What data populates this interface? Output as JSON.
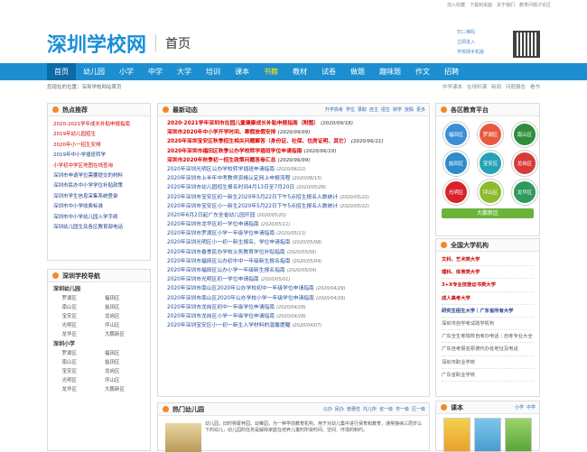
{
  "toplinks": [
    "加入收藏",
    "下载到桌面",
    "关于我们",
    "教育问题讨论区"
  ],
  "logo": {
    "text": "深圳学校网",
    "home": "首页"
  },
  "qr_links": [
    "扫二维码",
    "立即进入",
    "学校网手机版"
  ],
  "nav": [
    "首页",
    "幼儿园",
    "小学",
    "中学",
    "大学",
    "培训",
    "课本",
    "书籍",
    "教材",
    "试卷",
    "做题",
    "趣味题",
    "作文",
    "招聘"
  ],
  "crumb": {
    "text": "您现在的位置：深圳学校网站首页",
    "right": [
      "中学课本",
      "在线听课",
      "新闻",
      "问题报告",
      "看书"
    ]
  },
  "hot": {
    "title": "热点推荐",
    "items": [
      {
        "text": "2020-2021学年成长补贴申报指南",
        "c": "r"
      },
      {
        "text": "2019年幼儿园招生",
        "c": "r"
      },
      {
        "text": "2020年小一招生安排",
        "c": "r"
      },
      {
        "text": "2019年中小学插班转学",
        "c": "b"
      },
      {
        "text": "小学初中学区地图在线查询",
        "c": "r"
      },
      {
        "text": "深圳市申请学位需要提交的材料",
        "c": "b"
      },
      {
        "text": "深圳市民办中小学学位补贴政策",
        "c": "b"
      },
      {
        "text": "深圳市学生信息采集系统登录",
        "c": "b"
      },
      {
        "text": "深圳市中小学收费标准",
        "c": "b"
      },
      {
        "text": "深圳市中小学幼儿园入学手续",
        "c": "b"
      },
      {
        "text": "深圳幼儿园生及各区教育部电话",
        "c": "b"
      }
    ]
  },
  "sidenav": {
    "title": "深圳学校导航",
    "kinder_title": "深圳幼儿园",
    "kinder": [
      "罗湖区",
      "福田区",
      "南山区",
      "盐田区",
      "宝安区",
      "龙岗区",
      "光明区",
      "坪山区",
      "龙华区",
      "大鹏新区"
    ],
    "primary_title": "深圳小学",
    "primary": [
      "罗湖区",
      "福田区",
      "南山区",
      "盐田区",
      "宝安区",
      "龙岗区",
      "光明区",
      "坪山区",
      "龙华区",
      "大鹏新区"
    ]
  },
  "news": {
    "title": "最新动态",
    "tabs": [
      "升学高考",
      "学位",
      "录取",
      "自主",
      "招生",
      "转学",
      "放假",
      "更多"
    ],
    "items": [
      {
        "text": "2020-2021学年深圳市在园儿童健康成长补贴申报指南（附图）",
        "date": "(2020/09/18)",
        "bold": true
      },
      {
        "text": "深圳市2020年中小学开学时间、寒假放假安排",
        "date": "(2020/09/09)",
        "bold": true
      },
      {
        "text": "2020年深圳宝安区秋季招生相关问题解答（身份证、社保、住房证明、其它）",
        "date": "(2020/06/21)",
        "bold": true
      },
      {
        "text": "2020年深圳市福田区秋季公办学校转学插班学位申请指南",
        "date": "(2020/06/19)",
        "bold": true
      },
      {
        "text": "深圳市2020年秋季初一招生政策问题答卷汇总",
        "date": "(2020/06/09)",
        "bold": true
      },
      {
        "text": "2020年深圳光明区公办学校转学插班申请指南",
        "date": "(2020/06/22)",
        "bold": false
      },
      {
        "text": "2020年深圳市上半年中考教师资格认定网上申报流程",
        "date": "(2020/06/15)",
        "bold": false
      },
      {
        "text": "2020年深圳市幼儿园招生报名时间4月13日至7月20日",
        "date": "(2020/05/28)",
        "bold": false
      },
      {
        "text": "2020年深圳市宝安区初一新生2020年5月22日下午5点招生报名人数统计",
        "date": "(2020/05/22)",
        "bold": false
      },
      {
        "text": "2020年深圳市宝安区小一新生2020年5月22日下午5点招生报名人数统计",
        "date": "(2020/05/22)",
        "bold": false
      },
      {
        "text": "2020年6月2日起广东全省幼儿园开园",
        "date": "(2020/05/20)",
        "bold": false
      },
      {
        "text": "2020年深圳市龙华区初一学位申请指南",
        "date": "(2020/05/11)",
        "bold": false
      },
      {
        "text": "2020年深圳市罗湖区小学一年级学位申请指南",
        "date": "(2020/05/11)",
        "bold": false
      },
      {
        "text": "2020年深圳光明区小一初一新生报名、学位申请指南",
        "date": "(2020/05/08)",
        "bold": false
      },
      {
        "text": "2020年深圳市春季民办学校义务教育学位补贴指南",
        "date": "(2020/05/06)",
        "bold": false
      },
      {
        "text": "2020年深圳市福田区公办初中中一年级新生报名指南",
        "date": "(2020/05/04)",
        "bold": false
      },
      {
        "text": "2020年深圳市福田区公办小学一年级新生报名指南",
        "date": "(2020/05/04)",
        "bold": false
      },
      {
        "text": "2020年深圳市光明区初一学位申请指南",
        "date": "(2020/05/01)",
        "bold": false
      },
      {
        "text": "2020年深圳市南山区2020年公办学校初中一年级学位申请指南",
        "date": "(2020/04/29)",
        "bold": false
      },
      {
        "text": "2020年深圳市南山区2020年公办学校小学一年级学位申请指南",
        "date": "(2020/04/29)",
        "bold": false
      },
      {
        "text": "2020年深圳市龙岗区初中一年级学位申请指南",
        "date": "(2020/04/28)",
        "bold": false
      },
      {
        "text": "2020年深圳市龙岗区小学一年级学位申请指南",
        "date": "(2020/04/28)",
        "bold": false
      },
      {
        "text": "2020年深圳宝安区小一初一新生入学材料的温馨提醒",
        "date": "(2020/04/07)",
        "bold": false
      }
    ]
  },
  "kinder": {
    "title": "热门幼儿园",
    "tabs": [
      "公办",
      "民办",
      "普惠性",
      "托儿所",
      "省一级",
      "市一级",
      "区一级"
    ],
    "desc": "幼儿园，旧时称蒙养园、幼稚园，为一种学前教育机构，用于对幼儿集中进行保育和教育，通常接纳三周岁以下的幼儿，幼儿园的任务是解除家庭在培养儿童时所受时间、空间、环境的制约。"
  },
  "districts": {
    "title": "各区教育平台",
    "items": [
      {
        "name": "福田区",
        "color": "#3a8fd6"
      },
      {
        "name": "罗湖区",
        "color": "#e85a40"
      },
      {
        "name": "南山区",
        "color": "#2f8e3c"
      },
      {
        "name": "盐田区",
        "color": "#2d8cc9"
      },
      {
        "name": "宝安区",
        "color": "#25a2b8"
      },
      {
        "name": "龙岗区",
        "color": "#d83a3a"
      },
      {
        "name": "光明区",
        "color": "#d7232b"
      },
      {
        "name": "坪山区",
        "color": "#8dbb2e"
      },
      {
        "name": "龙华区",
        "color": "#2f9a5b"
      }
    ],
    "dapeng": "大鹏新区"
  },
  "univ": {
    "title": "全国大学机构",
    "items": [
      {
        "text": "文科、艺术类大学",
        "c": "red"
      },
      {
        "text": "理科、体育类大学",
        "c": "red"
      },
      {
        "text": "3+X专业技能证书类大学",
        "c": "red"
      },
      {
        "text": "成人高考大学",
        "c": "red"
      },
      {
        "text": "研究生招生大学｜广东省所有大学",
        "c": "blue"
      },
      {
        "text": "深圳市自学考试助学机构",
        "c": "gray"
      },
      {
        "text": "广东全生考院校自考办电话｜自考专业大全",
        "c": "gray"
      },
      {
        "text": "广东自考报名原德代办处地址及电话",
        "c": "gray"
      },
      {
        "text": "深圳市职业学校",
        "c": "gray"
      },
      {
        "text": "广东省职业学校",
        "c": "gray"
      }
    ]
  },
  "textbook": {
    "title": "课本",
    "tabs": [
      "小学",
      "中学"
    ]
  }
}
